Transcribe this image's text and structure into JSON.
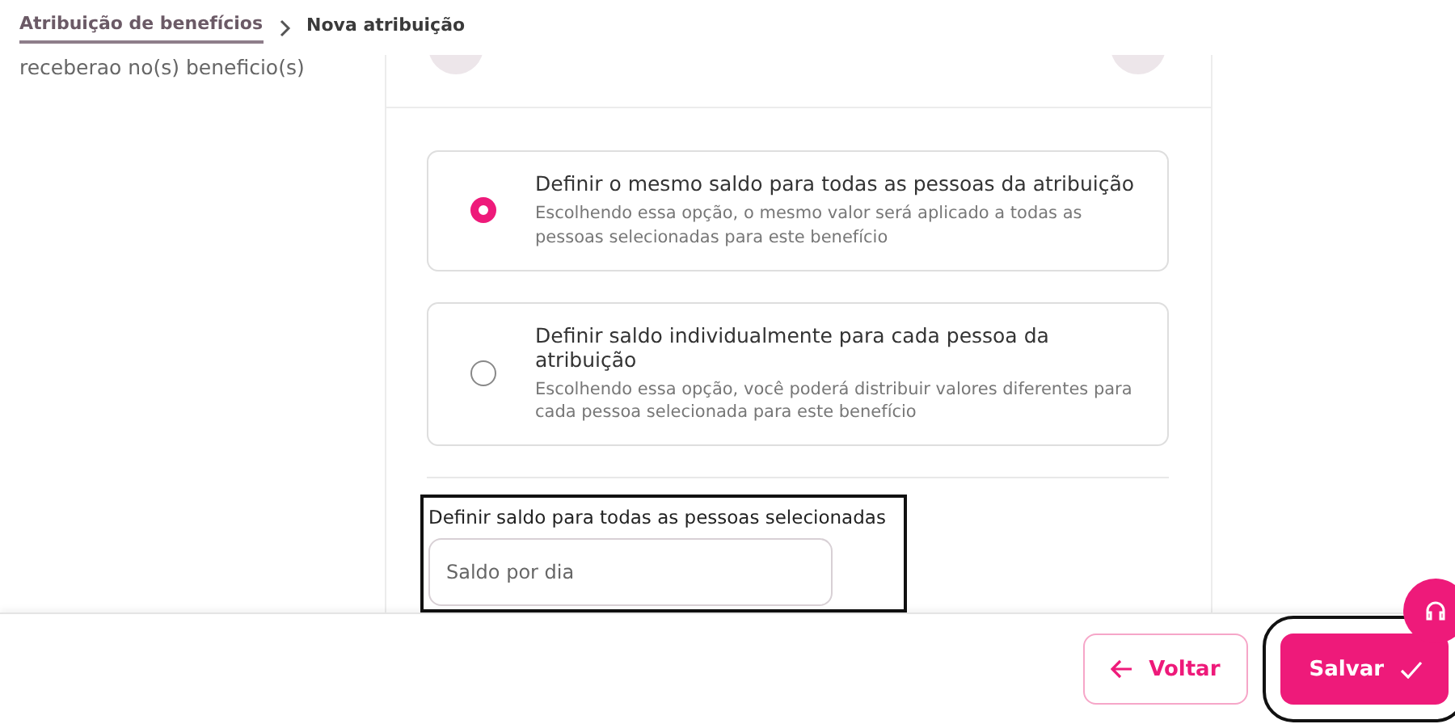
{
  "breadcrumb": [
    {
      "label": "Atribuição de benefícios",
      "selected": false
    },
    {
      "label": "Nova atribuição",
      "selected": true
    }
  ],
  "sidebar_text": "receberao no(s) beneficio(s)",
  "options": [
    {
      "title": "Definir o mesmo saldo para todas as pessoas da atribuição",
      "description": "Escolhendo essa opção, o mesmo valor será aplicado a todas as pessoas selecionadas para este benefício",
      "selected": true
    },
    {
      "title": "Definir saldo individualmente para cada pessoa da atribuição",
      "description": "Escolhendo essa opção, você poderá distribuir valores diferentes para cada pessoa selecionada para este benefício",
      "selected": false
    }
  ],
  "balance_field": {
    "label": "Definir saldo para todas as pessoas selecionadas",
    "placeholder": "Saldo por dia"
  },
  "buttons": [
    {
      "kind": "back",
      "label": "Voltar"
    },
    {
      "kind": "save",
      "label": "Salvar"
    }
  ]
}
